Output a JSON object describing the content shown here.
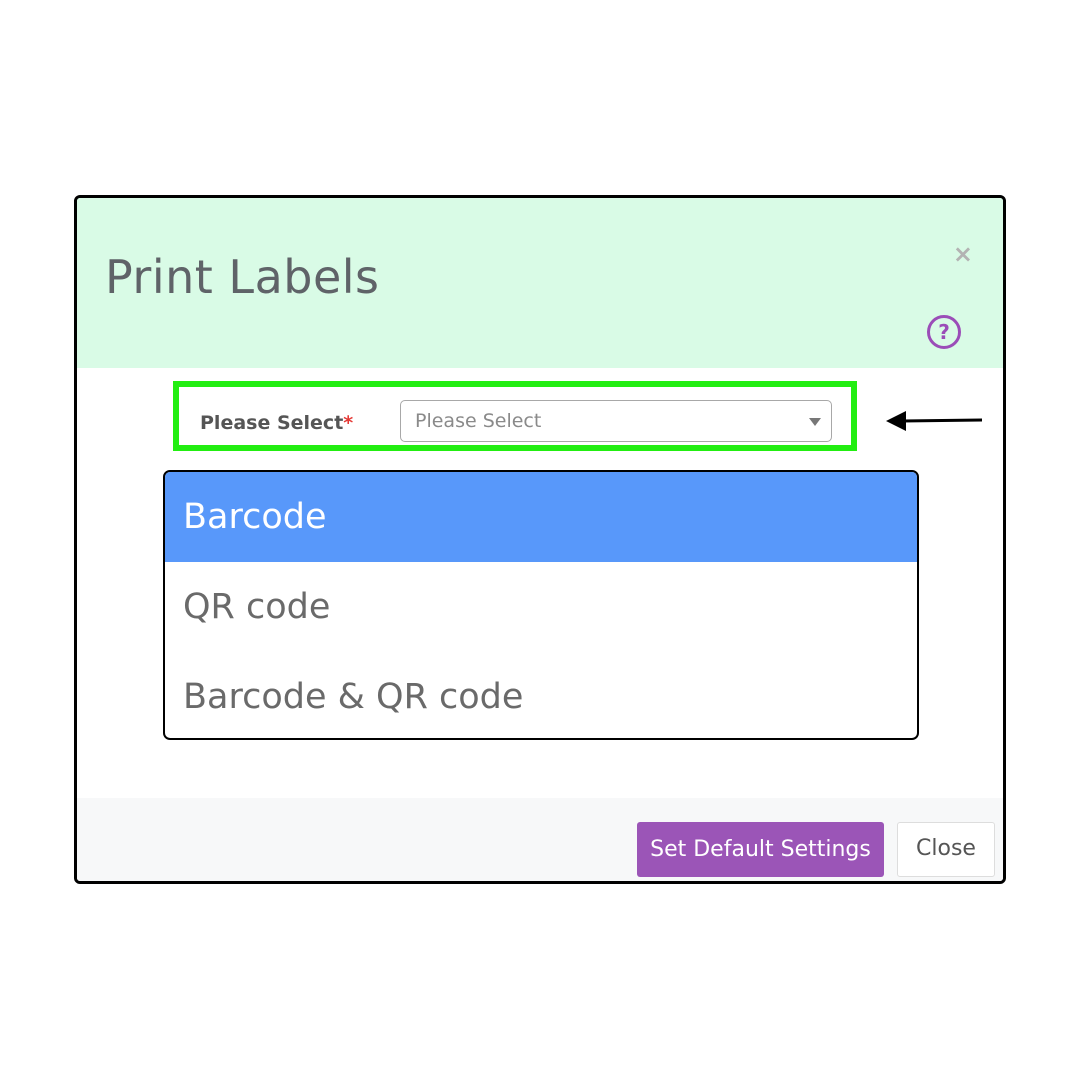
{
  "modal": {
    "title": "Print Labels",
    "close_glyph": "×",
    "help_glyph": "?"
  },
  "form": {
    "label": "Please Select",
    "required_marker": "*",
    "select": {
      "value": "Please Select"
    }
  },
  "dropdown": {
    "options": [
      {
        "label": "Barcode",
        "selected": true
      },
      {
        "label": "QR code",
        "selected": false
      },
      {
        "label": "Barcode & QR code",
        "selected": false
      }
    ]
  },
  "footer": {
    "primary_label": "Set Default Settings",
    "close_label": "Close"
  },
  "icons": {
    "close": "close-icon",
    "help": "help-circle-icon",
    "caret": "chevron-down-icon",
    "arrow": "arrow-left-icon"
  },
  "colors": {
    "header_bg": "#d9fbe6",
    "accent_purple": "#9b55b7",
    "highlight_green": "#22ee11",
    "selected_option": "#5898fa",
    "required": "#e53935"
  }
}
